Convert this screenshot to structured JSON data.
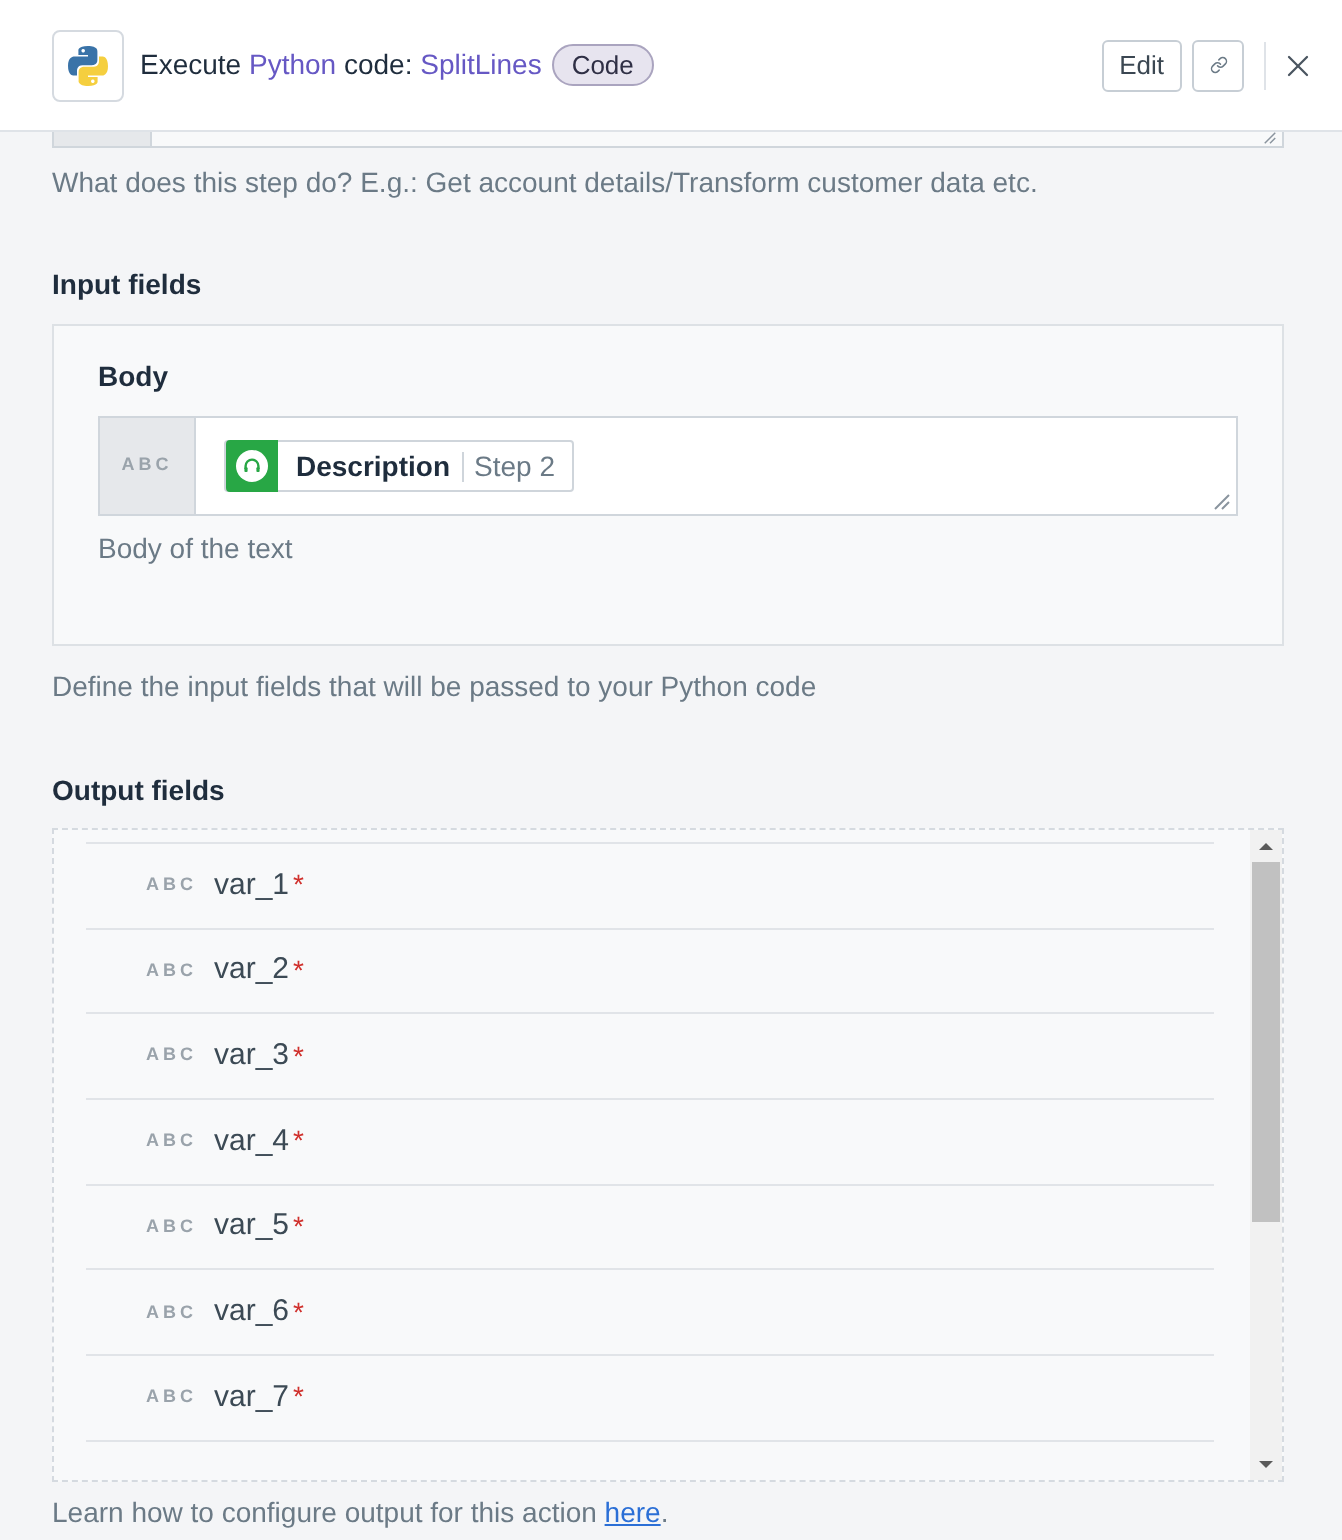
{
  "header": {
    "title": [
      {
        "text": "Execute",
        "kind": "plain"
      },
      {
        "text": "Python",
        "kind": "accent"
      },
      {
        "text": "code:",
        "kind": "plain"
      },
      {
        "text": "SplitLines",
        "kind": "accent"
      }
    ],
    "badge": "Code",
    "actions": [
      {
        "kind": "text",
        "label": "Edit"
      },
      {
        "kind": "link"
      },
      {
        "kind": "close"
      }
    ]
  },
  "description": {
    "help": "What does this step do? E.g.: Get account details/Transform customer data etc."
  },
  "input_fields": {
    "title": "Input fields",
    "fields": [
      {
        "label": "Body",
        "type": "ABC",
        "token": {
          "name": "Description",
          "step": "Step 2"
        },
        "help": "Body of the text"
      }
    ],
    "help": "Define the input fields that will be passed to your Python code"
  },
  "output_fields": {
    "title": "Output fields",
    "rows": [
      {
        "type": "ABC",
        "name": "var_1",
        "marker": "*"
      },
      {
        "type": "ABC",
        "name": "var_2",
        "marker": "*"
      },
      {
        "type": "ABC",
        "name": "var_3",
        "marker": "*"
      },
      {
        "type": "ABC",
        "name": "var_4",
        "marker": "*"
      },
      {
        "type": "ABC",
        "name": "var_5",
        "marker": "*"
      },
      {
        "type": "ABC",
        "name": "var_6",
        "marker": "*"
      },
      {
        "type": "ABC",
        "name": "var_7",
        "marker": "*"
      }
    ],
    "help": {
      "text": "Learn how to configure output for this action",
      "link": "here",
      "end": "."
    }
  }
}
